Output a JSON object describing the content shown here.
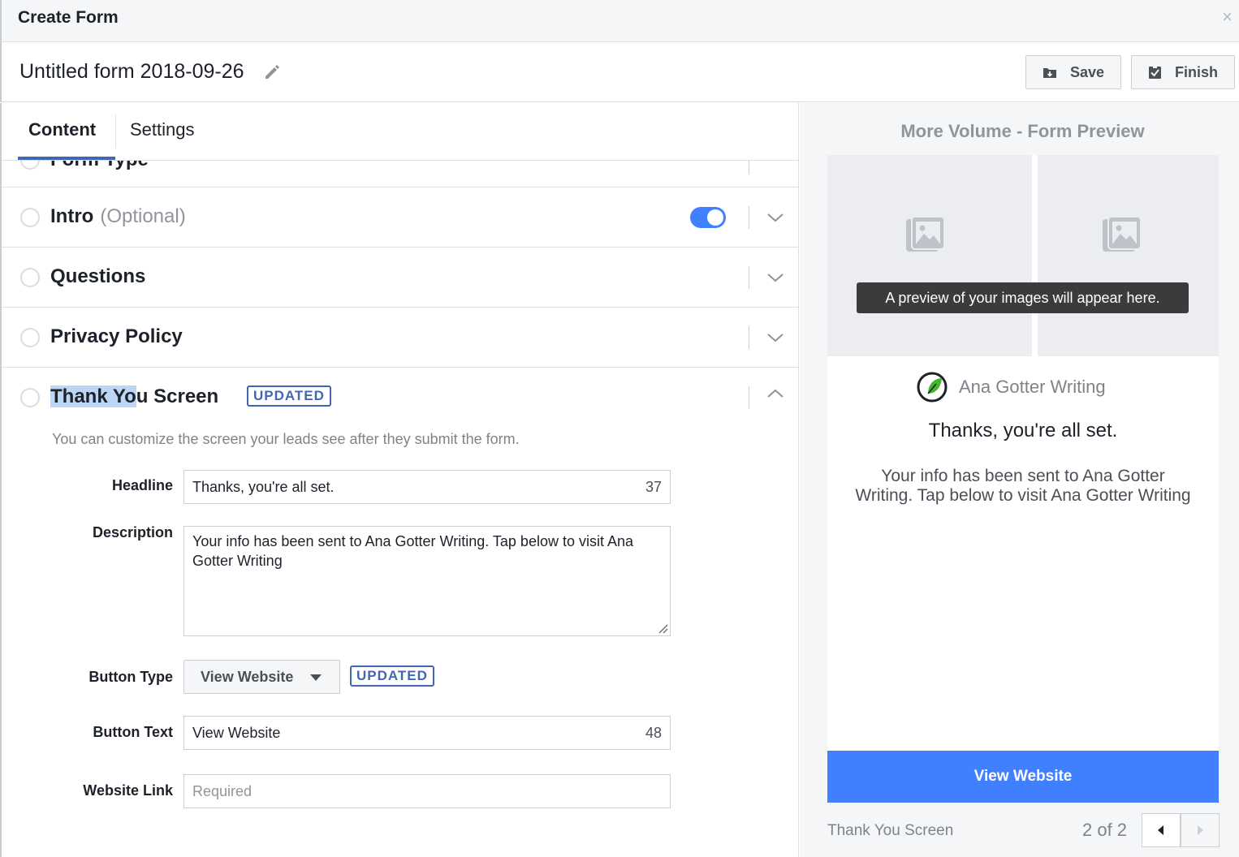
{
  "window": {
    "title": "Create Form",
    "close_glyph": "×"
  },
  "header": {
    "form_name": "Untitled form 2018-09-26",
    "save_label": "Save",
    "finish_label": "Finish"
  },
  "tabs": [
    {
      "label": "Content",
      "active": true
    },
    {
      "label": "Settings",
      "active": false
    }
  ],
  "sections": {
    "form_type": {
      "title": "Form Type"
    },
    "intro": {
      "title": "Intro",
      "optional": "(Optional)",
      "enabled": true
    },
    "questions": {
      "title": "Questions"
    },
    "privacy": {
      "title": "Privacy Policy"
    },
    "thank_you": {
      "title_highlighted": "Thank Yo",
      "title_rest": "u Screen",
      "badge": "UPDATED",
      "help_text": "You can customize the screen your leads see after they submit the form.",
      "fields": {
        "headline": {
          "label": "Headline",
          "value": "Thanks, you're all set.",
          "count": "37"
        },
        "description": {
          "label": "Description",
          "value": "Your info has been sent to Ana Gotter Writing. Tap below to visit Ana Gotter Writing"
        },
        "button_type": {
          "label": "Button Type",
          "value": "View Website",
          "badge": "UPDATED"
        },
        "button_text": {
          "label": "Button Text",
          "value": "View Website",
          "count": "48"
        },
        "website_link": {
          "label": "Website Link",
          "placeholder": "Required"
        }
      }
    }
  },
  "preview": {
    "title": "More Volume - Form Preview",
    "tooltip": "A preview of your images will appear here.",
    "brand_name": "Ana Gotter Writing",
    "headline": "Thanks, you're all set.",
    "description": "Your info has been sent to Ana Gotter Writing. Tap below to visit Ana Gotter Writing",
    "button": "View Website",
    "footer_label": "Thank You Screen",
    "page_indicator": "2 of 2"
  },
  "colors": {
    "accent": "#4267b2",
    "toggle_on": "#4080ff",
    "preview_button": "#4080ff",
    "highlight": "#bdd6f5"
  }
}
